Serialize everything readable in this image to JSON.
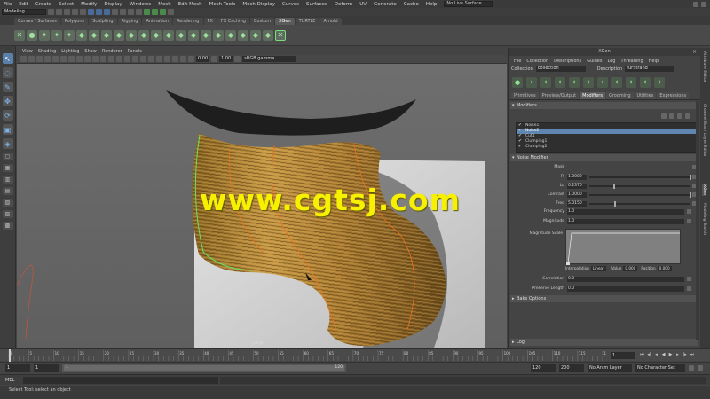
{
  "menu": {
    "items": [
      "File",
      "Edit",
      "Create",
      "Select",
      "Modify",
      "Display",
      "Windows",
      "Mesh",
      "Edit Mesh",
      "Mesh Tools",
      "Mesh Display",
      "Curves",
      "Surfaces",
      "Deform",
      "UV",
      "Generate",
      "Cache",
      "Help"
    ],
    "live_surface": "No Live Surface"
  },
  "status": {
    "mode": "Modeling"
  },
  "shelf_tabs": [
    "Curves / Surfaces",
    "Polygons",
    "Sculpting",
    "Rigging",
    "Animation",
    "Rendering",
    "FX",
    "FX Caching",
    "Custom",
    "XGen",
    "TURTLE",
    "Arnold"
  ],
  "shelf_active": "XGen",
  "viewport": {
    "menu": [
      "View",
      "Shading",
      "Lighting",
      "Show",
      "Renderer",
      "Panels"
    ],
    "near": "0.00",
    "far": "1.00",
    "color_space": "sRGB gamma",
    "label": "persp"
  },
  "watermark": "www.cgtsj.com",
  "xgen": {
    "title": "XGen",
    "menu": [
      "File",
      "Collection",
      "Descriptions",
      "Guides",
      "Log",
      "Threading",
      "Help"
    ],
    "collection_label": "Collection",
    "collection": "collection",
    "description_label": "Description",
    "description": "furStrand",
    "tabs": [
      "Primitives",
      "Preview/Output",
      "Modifiers",
      "Grooming",
      "Utilities",
      "Expressions"
    ],
    "active_tab": "Modifiers",
    "modifiers_header": "Modifiers",
    "modifiers": [
      "Noise1",
      "Noise2",
      "Cut1",
      "Clumping1",
      "Clumping2"
    ],
    "selected_modifier": "Noise2",
    "noise_header": "Noise Modifier",
    "mask_label": "Mask",
    "params": [
      {
        "label": "Ft",
        "value": "1.0000",
        "slider": 1.0
      },
      {
        "label": "Lo",
        "value": "0.2370",
        "slider": 0.237
      },
      {
        "label": "Contrast",
        "value": "1.0000",
        "slider": 1.0
      },
      {
        "label": "Freq",
        "value": "5.0150",
        "slider": 0.25
      }
    ],
    "frequency_label": "Frequency",
    "frequency": "1.0",
    "magnitude_label": "Magnitude",
    "magnitude": "1.0",
    "magnitude_scale_label": "Magnitude Scale",
    "interpolation_label": "Interpolation",
    "interpolation": "Linear",
    "value_label": "Value",
    "value": "0.000",
    "position_label": "Position",
    "position": "0.000",
    "correlation_label": "Correlation",
    "correlation": "0.0",
    "preserve_length_label": "Preserve Length",
    "preserve_length": "0.0",
    "bake_header": "Bake Options",
    "log_header": "Log"
  },
  "side_tabs": [
    "Attribute Editor",
    "Channel Box / Layer Editor",
    "XGen",
    "Modeling Toolkit"
  ],
  "side_tab_active": "XGen",
  "timeline": {
    "ticks": [
      "1",
      "5",
      "10",
      "15",
      "20",
      "25",
      "30",
      "35",
      "40",
      "45",
      "50",
      "55",
      "60",
      "65",
      "70",
      "75",
      "80",
      "85",
      "90",
      "95",
      "100",
      "105",
      "110",
      "115",
      "120"
    ],
    "current_frame": "1"
  },
  "range": {
    "start": "1",
    "inner_start": "1",
    "slider_start": "1",
    "slider_end": "120",
    "end": "120",
    "outer_end": "200",
    "anim_layer": "No Anim Layer",
    "char_set": "No Character Set"
  },
  "mel": {
    "label": "MEL"
  },
  "help": {
    "text": "Select Tool: select an object"
  }
}
